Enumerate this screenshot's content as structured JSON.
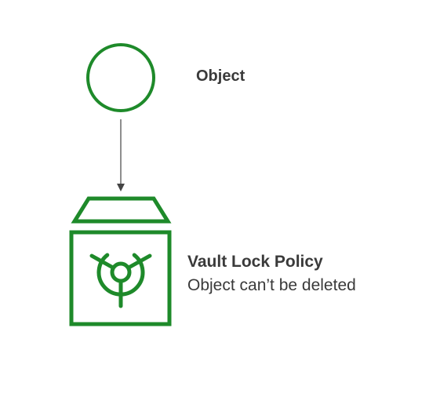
{
  "colors": {
    "accent": "#1e8a2a",
    "arrow": "#444444",
    "text": "#3a3a3a"
  },
  "object": {
    "label": "Object",
    "icon": "circle-icon"
  },
  "vault": {
    "title": "Vault Lock Policy",
    "subtitle": "Object can’t be deleted",
    "icon": "vault-icon"
  }
}
